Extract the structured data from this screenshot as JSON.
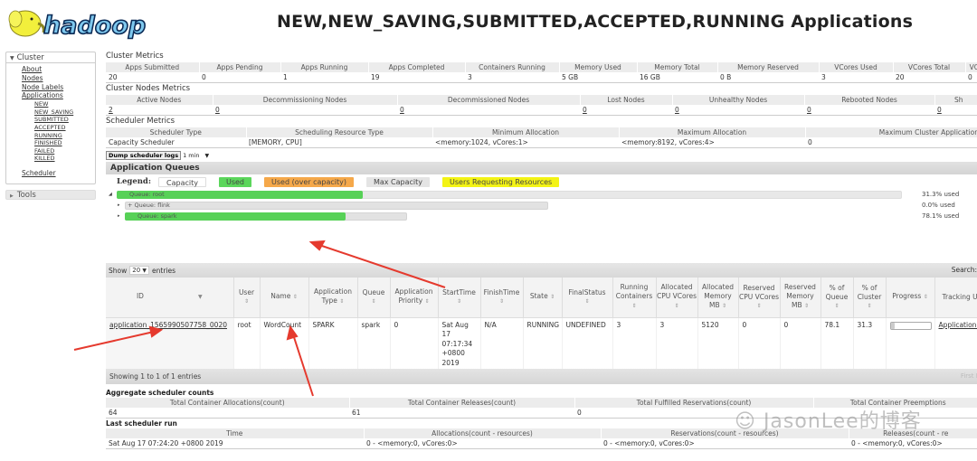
{
  "header": {
    "logo_text": "hadoop",
    "title": "NEW,NEW_SAVING,SUBMITTED,ACCEPTED,RUNNING Applications"
  },
  "sidebar": {
    "cluster_label": "Cluster",
    "links": [
      "About",
      "Nodes",
      "Node Labels",
      "Applications"
    ],
    "app_states": [
      "NEW",
      "NEW_SAVING",
      "SUBMITTED",
      "ACCEPTED",
      "RUNNING",
      "FINISHED",
      "FAILED",
      "KILLED"
    ],
    "scheduler_label": "Scheduler",
    "tools_label": "Tools"
  },
  "cluster_metrics": {
    "title": "Cluster Metrics",
    "headers": [
      "Apps Submitted",
      "Apps Pending",
      "Apps Running",
      "Apps Completed",
      "Containers Running",
      "Memory Used",
      "Memory Total",
      "Memory Reserved",
      "VCores Used",
      "VCores Total",
      "VC"
    ],
    "values": [
      "20",
      "0",
      "1",
      "19",
      "3",
      "5 GB",
      "16 GB",
      "0 B",
      "3",
      "20",
      "0"
    ]
  },
  "cluster_nodes_metrics": {
    "title": "Cluster Nodes Metrics",
    "headers": [
      "Active Nodes",
      "Decommissioning Nodes",
      "Decommissioned Nodes",
      "Lost Nodes",
      "Unhealthy Nodes",
      "Rebooted Nodes",
      "Sh"
    ],
    "values": [
      "2",
      "0",
      "0",
      "0",
      "0",
      "0",
      "0"
    ]
  },
  "scheduler_metrics": {
    "title": "Scheduler Metrics",
    "headers": [
      "Scheduler Type",
      "Scheduling Resource Type",
      "Minimum Allocation",
      "Maximum Allocation",
      "Maximum Cluster Application"
    ],
    "values": [
      "Capacity Scheduler",
      "[MEMORY, CPU]",
      "<memory:1024, vCores:1>",
      "<memory:8192, vCores:4>",
      "0"
    ]
  },
  "dump": {
    "button_label": "Dump scheduler logs",
    "interval": "1 min"
  },
  "app_queues": {
    "title": "Application Queues",
    "legend_label": "Legend:",
    "legend": [
      "Capacity",
      "Used",
      "Used (over capacity)",
      "Max Capacity",
      "Users Requesting Resources"
    ],
    "queues": [
      {
        "label": "Queue: root",
        "used_label": "31.3% used",
        "used_fraction": 0.313,
        "capacity_fraction": 1.0,
        "max_fraction": 1.0,
        "prefix": ""
      },
      {
        "label": "Queue: flink",
        "used_label": "0.0% used",
        "used_fraction": 0.0,
        "capacity_fraction": 0.6,
        "max_fraction": 1.0,
        "prefix": "+"
      },
      {
        "label": "Queue: spark",
        "used_label": "78.1% used",
        "used_fraction": 0.781,
        "capacity_fraction": 0.4,
        "max_fraction": 1.0,
        "prefix": ""
      }
    ]
  },
  "apps_table": {
    "show_label": "Show",
    "page_size": "20",
    "entries_label": "entries",
    "search_label": "Search:",
    "columns": [
      "ID",
      "User",
      "Name",
      "Application Type",
      "Queue",
      "Application Priority",
      "StartTime",
      "FinishTime",
      "State",
      "FinalStatus",
      "Running Containers",
      "Allocated CPU VCores",
      "Allocated Memory MB",
      "Reserved CPU VCores",
      "Reserved Memory MB",
      "% of Queue",
      "% of Cluster",
      "Progress",
      "Tracking UI"
    ],
    "rows": [
      {
        "id": "application_1565990507758_0020",
        "user": "root",
        "name": "WordCount",
        "type": "SPARK",
        "queue": "spark",
        "priority": "0",
        "start_time": "Sat Aug 17 07:17:34 +0800 2019",
        "finish_time": "N/A",
        "state": "RUNNING",
        "final_status": "UNDEFINED",
        "running_containers": "3",
        "alloc_vcores": "3",
        "alloc_mem": "5120",
        "res_vcores": "0",
        "res_mem": "0",
        "pct_queue": "78.1",
        "pct_cluster": "31.3",
        "progress": 0.1,
        "tracking": "ApplicationMaster"
      }
    ],
    "showing": "Showing 1 to 1 of 1 entries",
    "pager": "First  P"
  },
  "aggregate": {
    "title": "Aggregate scheduler counts",
    "headers": [
      "Total Container Allocations(count)",
      "Total Container Releases(count)",
      "Total Fulfilled Reservations(count)",
      "Total Container Preemptions"
    ],
    "values": [
      "64",
      "61",
      "0",
      ""
    ]
  },
  "last_run": {
    "title": "Last scheduler run",
    "headers": [
      "Time",
      "Allocations(count - resources)",
      "Reservations(count - resources)",
      "Releases(count - re"
    ],
    "values": [
      "Sat Aug 17 07:24:20 +0800 2019",
      "0 - <memory:0, vCores:0>",
      "0 - <memory:0, vCores:0>",
      "0 - <memory:0, vCores:0>"
    ]
  },
  "watermark": "JasonLee的博客",
  "colors": {
    "used": "#57d157",
    "over": "#f5a84a",
    "max": "#e4e4e4",
    "request": "#f3f315",
    "arrow": "#e53a2e"
  }
}
